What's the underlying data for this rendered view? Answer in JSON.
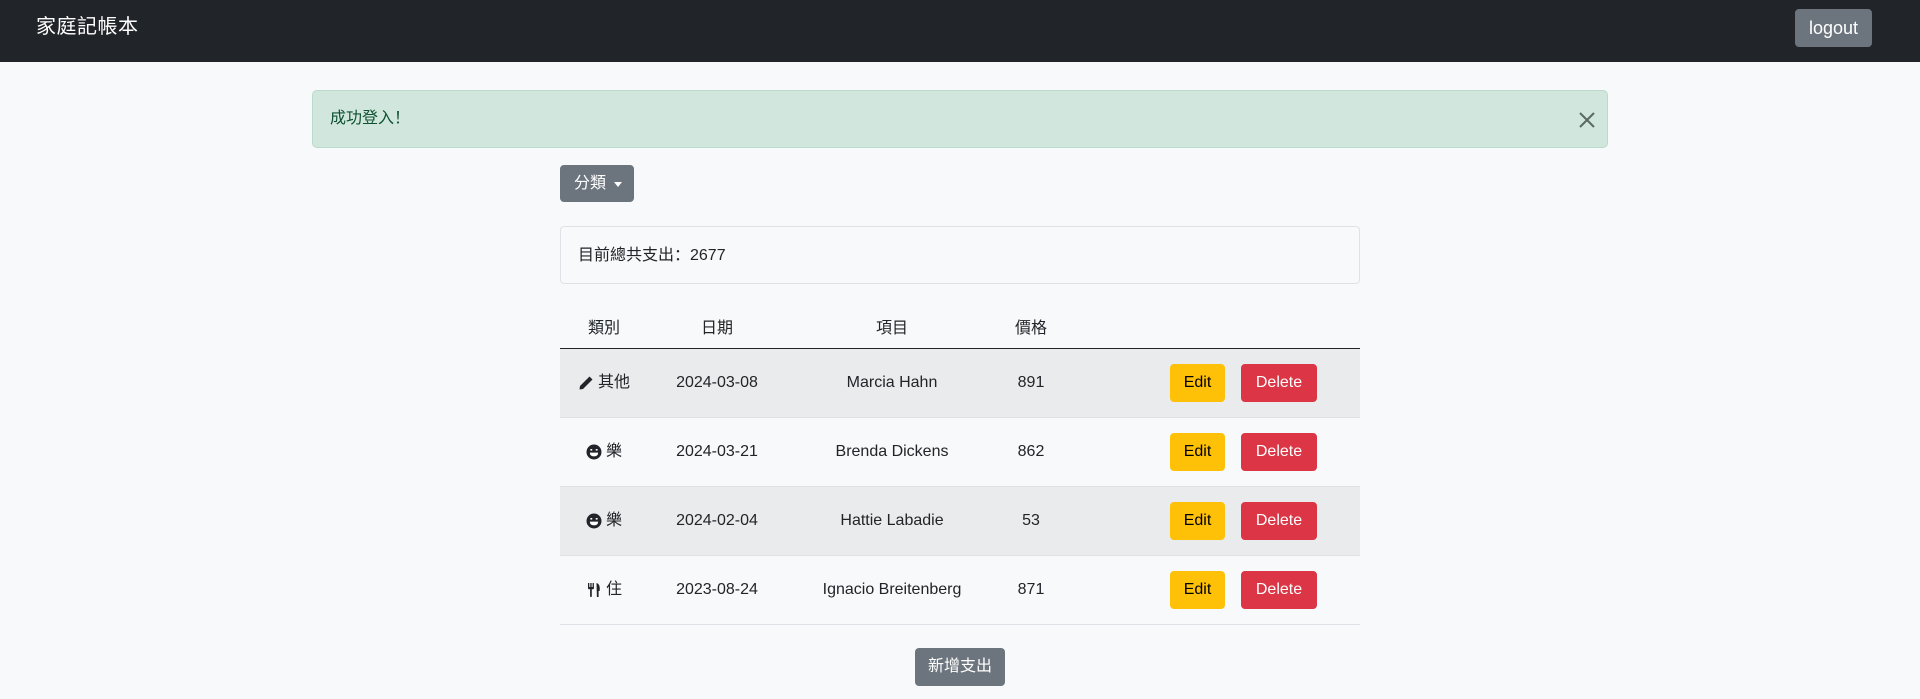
{
  "navbar": {
    "brand": "家庭記帳本",
    "logout_label": "logout"
  },
  "alert": {
    "message": "成功登入！",
    "close_icon": "close-icon"
  },
  "filter": {
    "category_label": "分類"
  },
  "summary": {
    "total_text": "目前總共支出：2677"
  },
  "table": {
    "headers": {
      "category": "類別",
      "date": "日期",
      "item": "項目",
      "price": "價格"
    },
    "rows": [
      {
        "icon": "pen-icon",
        "category": "其他",
        "date": "2024-03-08",
        "item": "Marcia Hahn",
        "price": "891",
        "edit_label": "Edit",
        "delete_label": "Delete"
      },
      {
        "icon": "grin-face-icon",
        "category": "樂",
        "date": "2024-03-21",
        "item": "Brenda Dickens",
        "price": "862",
        "edit_label": "Edit",
        "delete_label": "Delete"
      },
      {
        "icon": "grin-face-icon",
        "category": "樂",
        "date": "2024-02-04",
        "item": "Hattie Labadie",
        "price": "53",
        "edit_label": "Edit",
        "delete_label": "Delete"
      },
      {
        "icon": "utensils-icon",
        "category": "住",
        "date": "2023-08-24",
        "item": "Ignacio Breitenberg",
        "price": "871",
        "edit_label": "Edit",
        "delete_label": "Delete"
      }
    ]
  },
  "actions": {
    "add_expense_label": "新增支出"
  },
  "colors": {
    "navbar_bg": "#212529",
    "alert_bg": "#d1e7dd",
    "secondary": "#6c757d",
    "warning": "#ffc107",
    "danger": "#dc3545"
  }
}
